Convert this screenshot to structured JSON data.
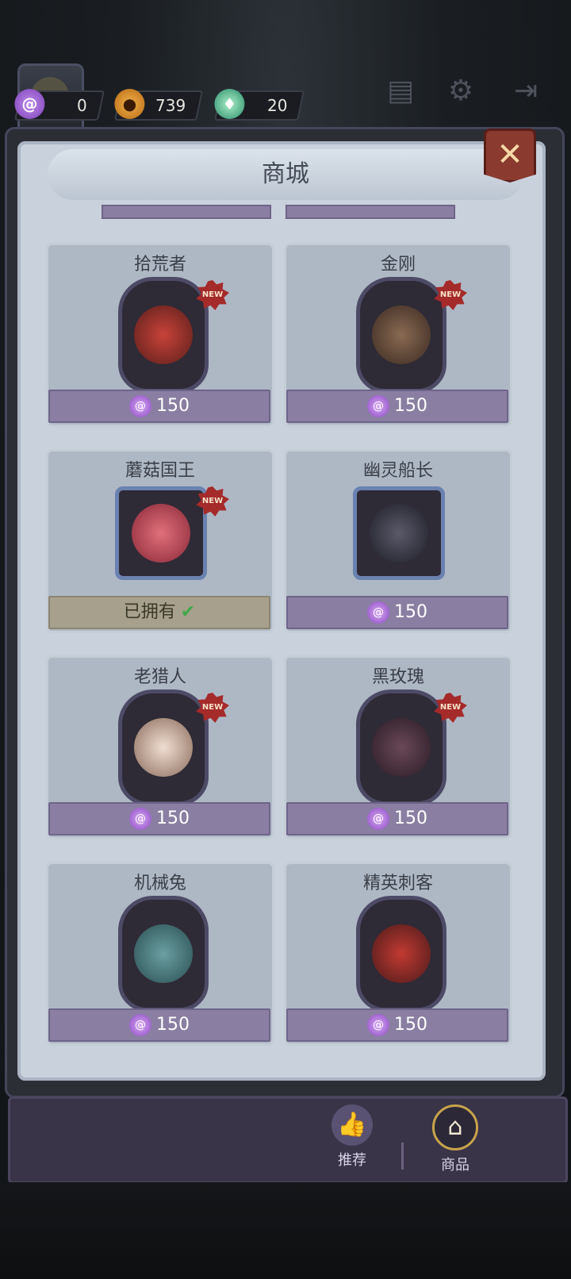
{
  "hud": {
    "candy_count": "0",
    "pumpkin_count": "739",
    "potion_count": "20"
  },
  "shop": {
    "title": "商城",
    "close_label": "✕"
  },
  "items": [
    {
      "name": "拾荒者",
      "price": "150",
      "new": "NEW",
      "owned": false
    },
    {
      "name": "金刚",
      "price": "150",
      "new": "NEW",
      "owned": false
    },
    {
      "name": "蘑菇国王",
      "price": "",
      "new": "NEW",
      "owned": true,
      "owned_label": "已拥有"
    },
    {
      "name": "幽灵船长",
      "price": "150",
      "new": "",
      "owned": false
    },
    {
      "name": "老猎人",
      "price": "150",
      "new": "NEW",
      "owned": false
    },
    {
      "name": "黑玫瑰",
      "price": "150",
      "new": "NEW",
      "owned": false
    },
    {
      "name": "机械兔",
      "price": "150",
      "new": "",
      "owned": false
    },
    {
      "name": "精英刺客",
      "price": "150",
      "new": "",
      "owned": false
    }
  ],
  "nav": {
    "recommend_label": "推荐",
    "goods_label": "商品"
  },
  "colors": {
    "panel": "#c9d1dc",
    "price_bar": "#8a7fa2",
    "owned_bar": "#a6a08c",
    "new_badge": "#a52a2a"
  }
}
